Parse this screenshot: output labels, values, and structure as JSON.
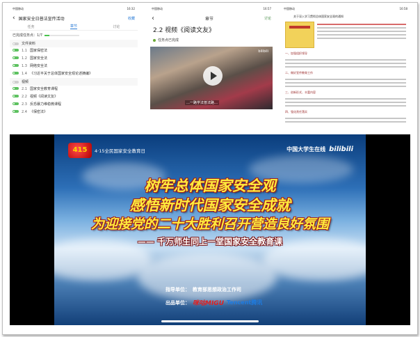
{
  "shot1": {
    "status_left": "中国移动",
    "status_right": "16:32",
    "title": "国家安全日普法宣传活动",
    "title_right": "收藏",
    "tabs": [
      "任务",
      "章节",
      "讨论"
    ],
    "active_tab": 1,
    "progress_label": "已完成任务点：",
    "progress_value": "1/7",
    "progress_fraction": 0.14,
    "groups": [
      {
        "label": "文件资料",
        "items": [
          {
            "num": "1.1",
            "text": "国家保密法"
          },
          {
            "num": "1.2",
            "text": "国家安全法"
          },
          {
            "num": "1.3",
            "text": "网络安全法"
          },
          {
            "num": "1.4",
            "text": "《习近平关于总体国家安全观论述摘编》"
          }
        ]
      },
      {
        "label": "视频",
        "items": [
          {
            "num": "2.1",
            "text": "国家安全教育课程"
          },
          {
            "num": "2.2",
            "text": "视频《阅读文友》"
          },
          {
            "num": "2.3",
            "text": "反恐暴力维稳微课程"
          },
          {
            "num": "2.4",
            "text": "《保密法》"
          }
        ]
      }
    ]
  },
  "shot2": {
    "status_left": "中国移动",
    "status_right": "16:57",
    "nav_title": "章节",
    "nav_right": "讨论",
    "heading": "2.2 视频《阅读文友》",
    "done_label": "任务点已完成",
    "video_subtitle": "…一路学法普法路…",
    "video_watermark": "bilibili"
  },
  "shot3": {
    "status_left": "中国移动",
    "status_right": "16:58",
    "title": "关于深入学习贯彻总体国家安全观的通知",
    "sections": [
      "一、加强组织领导",
      "二、做好宣传教育工作",
      "三、创新形式、丰富内容",
      "四、强化责任落实"
    ]
  },
  "big": {
    "logo_badge": "415",
    "logo_text": "4·15全民国家安全教育日",
    "brand_text": "中国大学生在线",
    "brand_bili": "bilibili",
    "line1": "树牢总体国家安全观",
    "line2": "感悟新时代国家安全成就",
    "line3": "为迎接党的二十大胜利召开营造良好氛围",
    "line4": "—— 千万师生同上一堂国家安全教育课",
    "guide_label": "指导单位：",
    "guide_value": "教育部思想政治工作司",
    "producer_label": "出品单位：",
    "producer_1": "咪咕MIGU",
    "producer_2": "Tencent腾讯"
  }
}
